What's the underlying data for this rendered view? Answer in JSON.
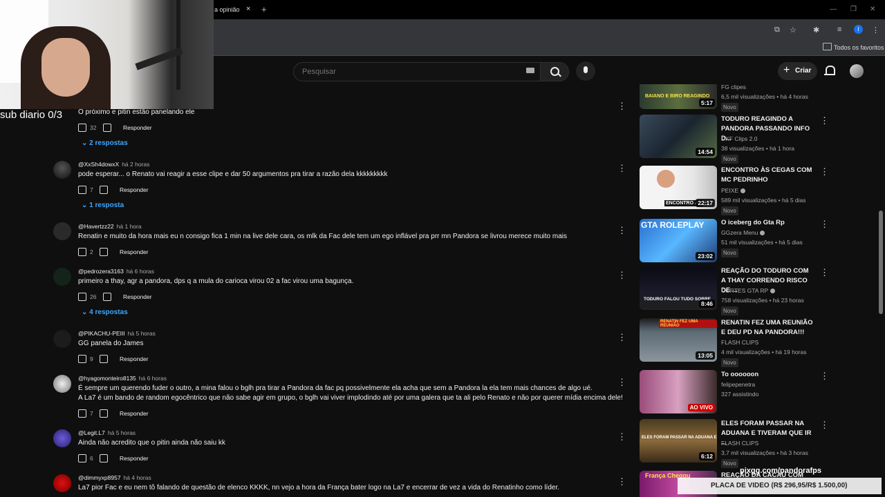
{
  "browser": {
    "tab_title": "a opinião",
    "tab_close": "×",
    "new_tab": "+",
    "bookmark_folder": "Todos os favoritos",
    "profile_initial": "I"
  },
  "header": {
    "search_placeholder": "Pesquisar",
    "create_label": "Criar"
  },
  "overlay": {
    "sub_text": "sub diario 0/3",
    "url_text": "pixgg.com/pandorafps",
    "goal_text": "PLACA DE VIDEO (R$ 296,95/R$ 1.500,00)"
  },
  "comments": [
    {
      "author": "",
      "time": "",
      "text": "O próximo e pitin estão panelando ele",
      "likes": "32",
      "reply": "Responder",
      "replies": "2 respostas"
    },
    {
      "author": "@XxSh4dowxX",
      "time": "há 2 horas",
      "text": "pode esperar... o Renato vai reagir a esse clipe e dar 50 argumentos pra tirar a razão dela kkkkkkkkk",
      "likes": "7",
      "reply": "Responder",
      "replies": "1 resposta"
    },
    {
      "author": "@Havertzz22",
      "time": "há 1 hora",
      "text": "Renatin e muito da hora mais eu n consigo fica 1 min na live dele cara, os mlk da Fac dele tem um ego inflável pra prr mn Pandora se livrou merece muito mais",
      "likes": "2",
      "reply": "Responder",
      "replies": ""
    },
    {
      "author": "@pedrozera3163",
      "time": "há 6 horas",
      "text": "primeiro a thay, agr a pandora, dps q a mula do carioca virou 02 a fac virou uma bagunça.",
      "likes": "26",
      "reply": "Responder",
      "replies": "4 respostas"
    },
    {
      "author": "@PIKACHU-PEIII",
      "time": "há 5 horas",
      "text": "GG panela do James",
      "likes": "9",
      "reply": "Responder",
      "replies": ""
    },
    {
      "author": "@hyagomonteiro8135",
      "time": "há 6 horas",
      "text": "É sempre um querendo fuder o outro, a mina falou o bglh pra tirar a Pandora da fac pq possivelmente ela acha que sem a Pandora la ela tem mais chances de algo ué.",
      "text2": "A La7 é um bando de random egocêntrico que não sabe agir em grupo, o bglh vai viver implodindo até por uma galera que ta ali pelo Renato e não por querer mídia encima dele!",
      "likes": "7",
      "reply": "Responder",
      "replies": ""
    },
    {
      "author": "@Legit.L7",
      "time": "há 5 horas",
      "text": "Ainda não acredito que o pitin ainda não saiu kk",
      "likes": "6",
      "reply": "Responder",
      "replies": ""
    },
    {
      "author": "@dimmyxp8957",
      "time": "há 4 horas",
      "text": "La7 pior Fac e eu nem tô falando de questão de elenco KKKK, nn vejo a hora da França bater logo na La7 e encerrar de vez a vida do Renatinho como líder.",
      "likes": "",
      "reply": "",
      "replies": ""
    }
  ],
  "related": [
    {
      "title": "",
      "channel": "FG clipes",
      "meta": "6,5 mil visualizações • há 4 horas",
      "badge": "Novo",
      "duration": "5:17",
      "thumb_text": "BAIANO E BIRO REAGINDO"
    },
    {
      "title": "TODURO REAGINDO A PANDORA PASSANDO INFO D...",
      "channel": "DKF Clips 2.0",
      "meta": "38 visualizações • há 1 hora",
      "badge": "Novo",
      "duration": "14:54",
      "thumb_text": ""
    },
    {
      "title": "ENCONTRO ÀS CEGAS COM MC PEDRINHO",
      "channel": "PEIXE",
      "meta": "589 mil visualizações • há 5 dias",
      "badge": "Novo",
      "duration": "22:17",
      "thumb_text": "ENCONTRO ÀS"
    },
    {
      "title": "O iceberg do Gta Rp",
      "channel": "GGzera Menu",
      "meta": "51 mil visualizações • há 5 dias",
      "badge": "Novo",
      "duration": "23:02",
      "thumb_text": "GTA ROLEPLAY"
    },
    {
      "title": "REAÇÃO DO TODURO COM A THAY CORRENDO RISCO DE ...",
      "channel": "CORTES GTA RP",
      "meta": "758 visualizações • há 23 horas",
      "badge": "Novo",
      "duration": "8:46",
      "thumb_text": "TODURO FALOU TUDO SOBRE"
    },
    {
      "title": "RENATIN FEZ UMA REUNIÃO E DEU PD NA PANDORA!!!",
      "channel": "FLASH CLIPS",
      "meta": "4 mil visualizações • há 19 horas",
      "badge": "Novo",
      "duration": "13:05",
      "thumb_text": "RENATIN FEZ UMA REUNIÃO"
    },
    {
      "title": "To oooooon",
      "channel": "felipepenetra",
      "meta": "327 assistindo",
      "badge": "",
      "duration": "AO VIVO",
      "thumb_text": ""
    },
    {
      "title": "ELES FORAM PASSAR NA ADUANA E TIVERAM QUE IR ...",
      "channel": "FLASH CLIPS",
      "meta": "3,7 mil visualizações • há 3 horas",
      "badge": "Novo",
      "duration": "6:12",
      "thumb_text": "ELES FORAM PASSAR NA ADUANA E"
    },
    {
      "title": "REAÇÃO DA CACAU COM",
      "channel": "",
      "meta": "",
      "badge": "",
      "duration": "",
      "thumb_text": "França Cheggu"
    }
  ]
}
